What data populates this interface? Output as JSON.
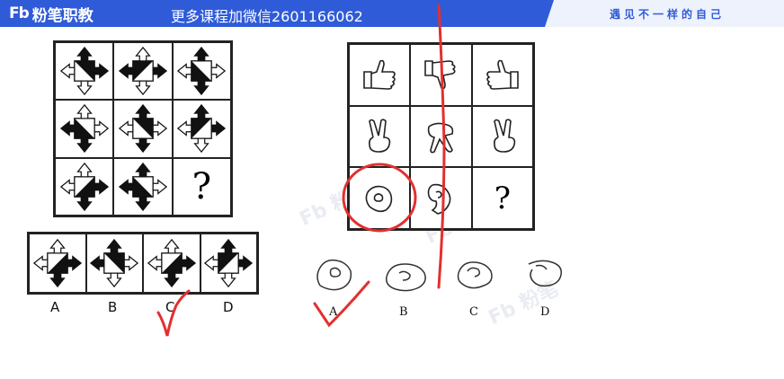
{
  "header": {
    "logo_mark": "Fb",
    "logo_text": "粉笔职教",
    "promo": "更多课程加微信2601166062",
    "slogan": "遇见不一样的自己"
  },
  "left_puzzle": {
    "question_mark": "?",
    "options": [
      "A",
      "B",
      "C",
      "D"
    ]
  },
  "right_puzzle": {
    "question_mark": "?",
    "options": [
      "A",
      "B",
      "C",
      "D"
    ]
  },
  "watermark": {
    "text": "Fb 粉笔"
  },
  "colors": {
    "brand": "#2f5bd8",
    "annotation": "#e23030"
  }
}
